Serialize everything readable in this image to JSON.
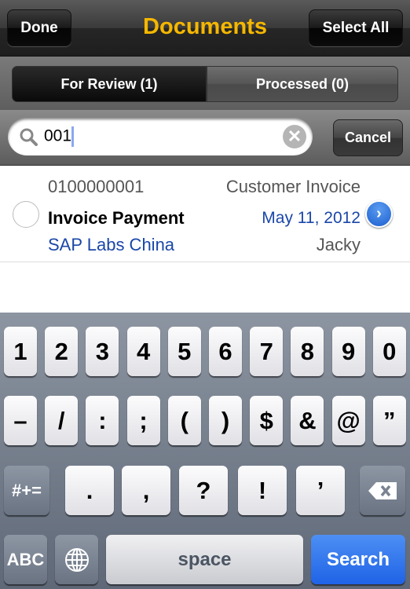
{
  "nav": {
    "done": "Done",
    "title": "Documents",
    "select_all": "Select All"
  },
  "segments": [
    {
      "label": "For Review (1)",
      "selected": true
    },
    {
      "label": "Processed (0)",
      "selected": false
    }
  ],
  "search": {
    "value": "001",
    "cancel": "Cancel",
    "icon": "search-icon"
  },
  "results": [
    {
      "number": "0100000001",
      "type": "Customer Invoice",
      "title": "Invoice Payment",
      "date": "May 11, 2012",
      "company": "SAP Labs China",
      "owner": "Jacky"
    }
  ],
  "keyboard": {
    "row1": [
      "1",
      "2",
      "3",
      "4",
      "5",
      "6",
      "7",
      "8",
      "9",
      "0"
    ],
    "row2": [
      "–",
      "/",
      ":",
      ";",
      "(",
      ")",
      "$",
      "&",
      "@",
      "”"
    ],
    "row3": {
      "shift": "#+=",
      "keys": [
        ".",
        ",",
        "?",
        "!",
        "’"
      ]
    },
    "row4": {
      "abc": "ABC",
      "space": "space",
      "search": "Search"
    }
  },
  "colors": {
    "title": "#f5b700",
    "link": "#1a47a8",
    "search_key": "#2a6ef0"
  }
}
